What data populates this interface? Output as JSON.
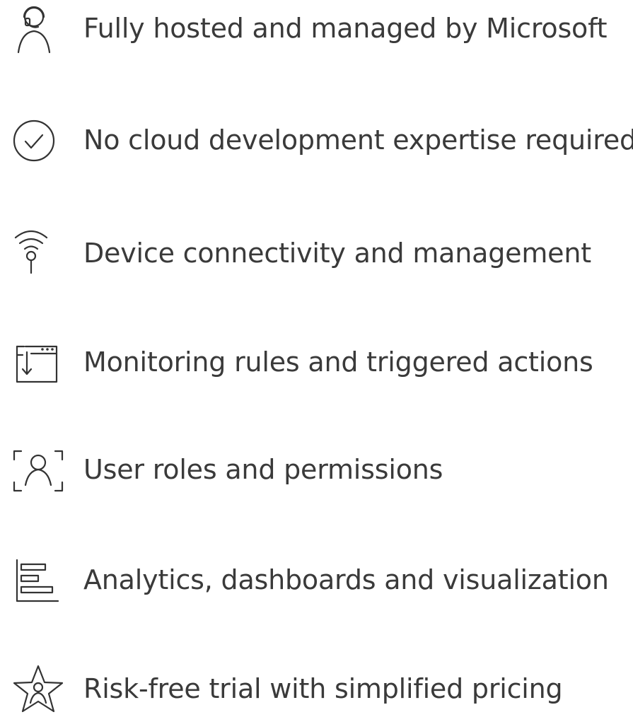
{
  "features": [
    {
      "icon": "headset-user-icon",
      "label": "Fully hosted and managed by Microsoft"
    },
    {
      "icon": "checkmark-circle-icon",
      "label": "No cloud development expertise required"
    },
    {
      "icon": "wifi-device-icon",
      "label": "Device connectivity and management"
    },
    {
      "icon": "monitoring-window-icon",
      "label": "Monitoring rules and triggered actions"
    },
    {
      "icon": "user-frame-icon",
      "label": "User roles and permissions"
    },
    {
      "icon": "bar-chart-icon",
      "label": "Analytics, dashboards and visualization"
    },
    {
      "icon": "star-user-icon",
      "label": "Risk-free trial with simplified pricing"
    }
  ],
  "colors": {
    "text": "#3a3a3a",
    "icon": "#333333",
    "background": "#ffffff"
  }
}
